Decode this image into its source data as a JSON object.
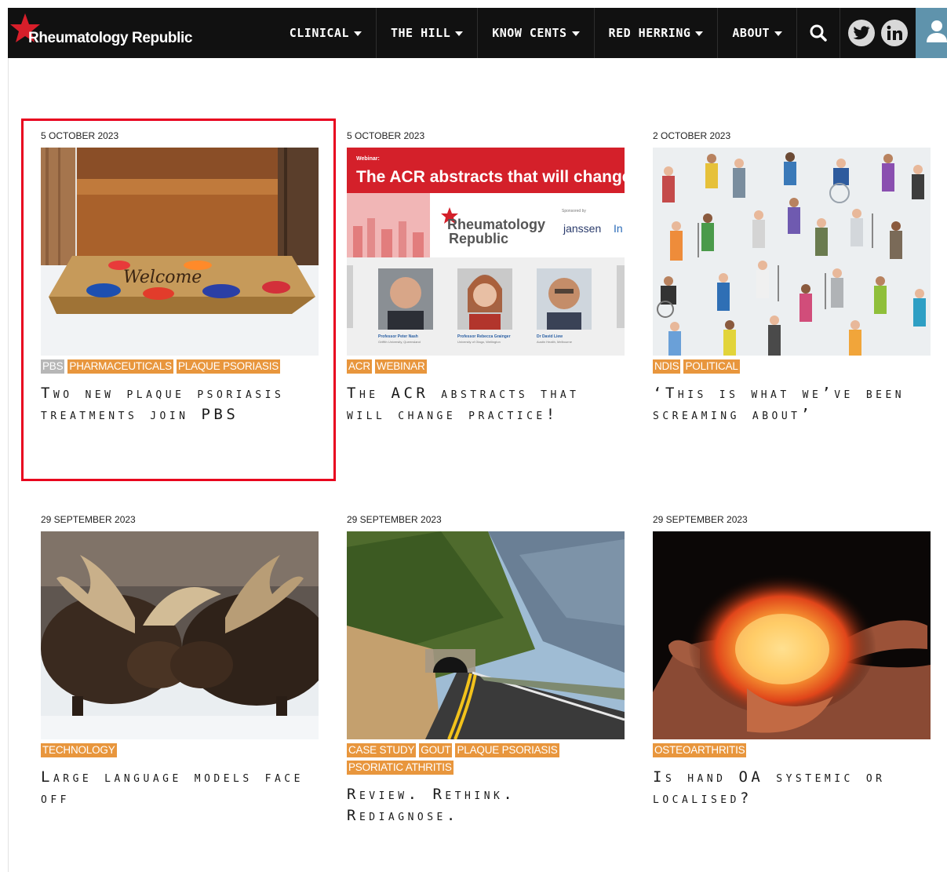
{
  "site": {
    "name": "Rheumatology Republic",
    "colors": {
      "header_bg": "#111111",
      "accent_star": "#d81e2a",
      "tag": "#e8963d",
      "tag_grey": "#b7b7b7",
      "user_button": "#5f93ac",
      "highlight": "#e8001e"
    }
  },
  "nav": {
    "items": [
      {
        "label": "CLINICAL"
      },
      {
        "label": "THE HILL"
      },
      {
        "label": "KNOW CENTS"
      },
      {
        "label": "RED HERRING"
      },
      {
        "label": "ABOUT"
      }
    ],
    "icons": {
      "search": "search-icon",
      "twitter": "twitter-icon",
      "linkedin": "linkedin-icon",
      "user": "user-icon"
    }
  },
  "articles": [
    {
      "date": "5 OCTOBER 2023",
      "tags": [
        {
          "label": "PBS",
          "grey": true
        },
        {
          "label": "PHARMACEUTICALS"
        },
        {
          "label": "PLAQUE PSORIASIS"
        }
      ],
      "title": "Two new plaque psoriasis treatments join PBS",
      "image": {
        "mat_text": "Welcome"
      }
    },
    {
      "date": "5 OCTOBER 2023",
      "tags": [
        {
          "label": "ACR"
        },
        {
          "label": "WEBINAR"
        }
      ],
      "title": "The ACR abstracts that will change practice!",
      "image": {
        "kicker": "Webinar:",
        "headline": "The ACR abstracts that will change p",
        "brand_line1": "Rheumatology",
        "brand_line2": "Republic",
        "sponsor_label": "Sponsored by",
        "sponsor": "janssen",
        "sponsor_suffix": "In",
        "speakers": [
          {
            "name": "Professor Peter Nash",
            "affil": "Griffith University, Queensland"
          },
          {
            "name": "Professor Rebecca Grainger",
            "affil": "University of Otago, Wellington"
          },
          {
            "name": "Dr David Liew",
            "affil": "Austin Health, Melbourne"
          }
        ]
      }
    },
    {
      "date": "2 OCTOBER 2023",
      "tags": [
        {
          "label": "NDIS"
        },
        {
          "label": "POLITICAL"
        }
      ],
      "title": "‘This is what we’ve been screaming about’",
      "image": {}
    },
    {
      "date": "29 SEPTEMBER 2023",
      "tags": [
        {
          "label": "TECHNOLOGY"
        }
      ],
      "title": "Large language models face off",
      "image": {}
    },
    {
      "date": "29 SEPTEMBER 2023",
      "tags": [
        {
          "label": "CASE STUDY"
        },
        {
          "label": "GOUT"
        },
        {
          "label": "PLAQUE PSORIASIS"
        },
        {
          "label": "PSORIATIC ATHRITIS"
        }
      ],
      "title": "Review. Rethink. Rediagnose.",
      "image": {}
    },
    {
      "date": "29 SEPTEMBER 2023",
      "tags": [
        {
          "label": "OSTEOARTHRITIS"
        }
      ],
      "title": "Is hand OA systemic or localised?",
      "image": {}
    }
  ]
}
